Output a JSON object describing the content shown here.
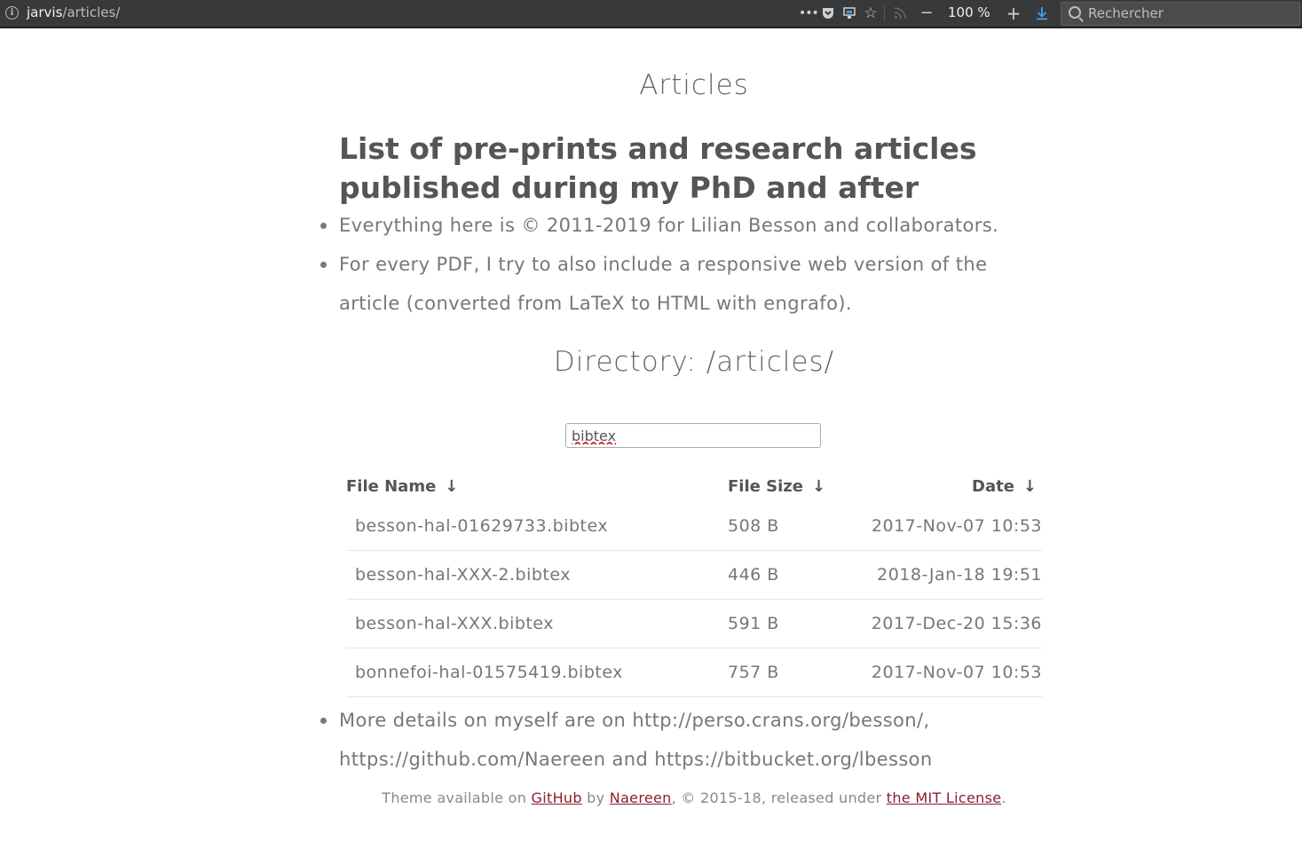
{
  "browser": {
    "url_host": "jarvis",
    "url_path": "/articles/",
    "zoom": "100 %",
    "search_placeholder": "Rechercher",
    "icons": [
      "info-icon",
      "more-icon",
      "pocket-icon",
      "screenshot-icon",
      "bookmark-star-icon",
      "rss-icon",
      "zoom-out-icon",
      "zoom-in-icon",
      "download-icon",
      "search-icon"
    ]
  },
  "page": {
    "title": "Articles",
    "headline": "List of pre-prints and research articles published during my PhD and after",
    "bullets": [
      "Everything here is © 2011-2019 for Lilian Besson and collaborators.",
      "For every PDF, I try to also include a responsive web version of the article (converted from LaTeX to HTML with engrafo)."
    ],
    "directory": "Directory: /articles/",
    "filter_value": "bibtex"
  },
  "table": {
    "headers": {
      "name": "File Name",
      "size": "File Size",
      "date": "Date",
      "sort_arrow": "↓"
    },
    "rows": [
      {
        "name": "besson-hal-01629733.bibtex",
        "size": "508 B",
        "date": "2017-Nov-07 10:53"
      },
      {
        "name": "besson-hal-XXX-2.bibtex",
        "size": "446 B",
        "date": "2018-Jan-18 19:51"
      },
      {
        "name": "besson-hal-XXX.bibtex",
        "size": "591 B",
        "date": "2017-Dec-20 15:36"
      },
      {
        "name": "bonnefoi-hal-01575419.bibtex",
        "size": "757 B",
        "date": "2017-Nov-07 10:53"
      }
    ]
  },
  "after_bullet": "More details on myself are on http://perso.crans.org/besson/, https://github.com/Naereen and https://bitbucket.org/lbesson",
  "footer": {
    "t1": "Theme available on ",
    "github": "GitHub",
    "t2": " by ",
    "author": "Naereen",
    "t3": ", © 2015-18, released under ",
    "license": "the MIT License",
    "t4": "."
  },
  "colors": {
    "link": "#8b1e2e",
    "toolbar_bg": "#38393b",
    "download_accent": "#3ea0f0"
  }
}
